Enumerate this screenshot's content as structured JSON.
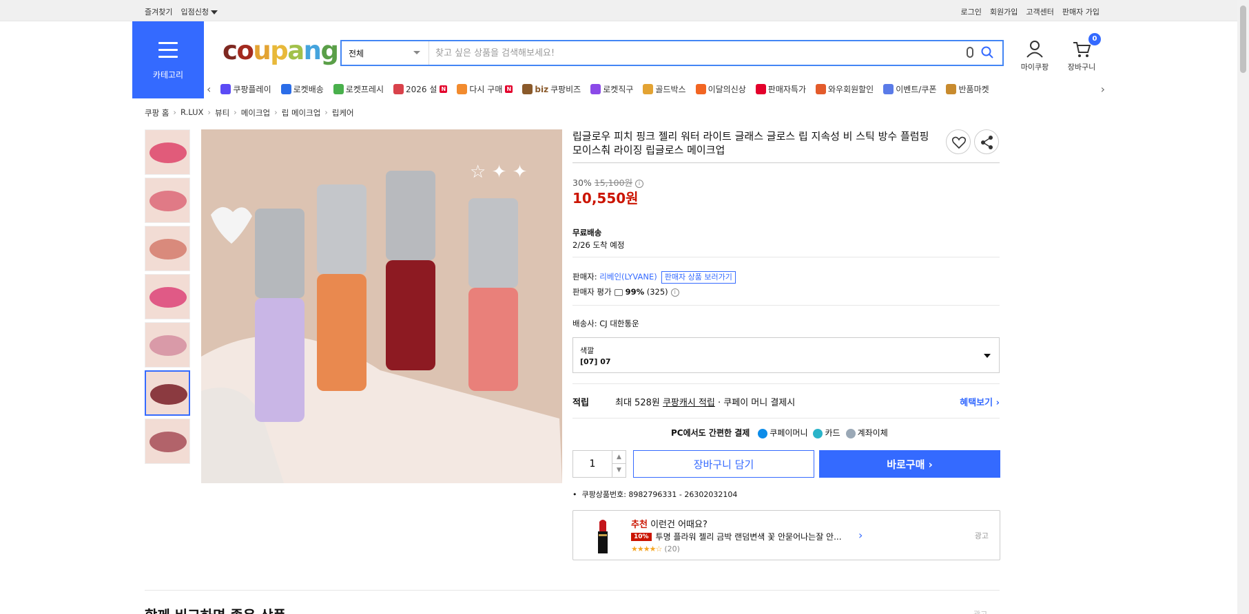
{
  "topbar": {
    "left": [
      "즐겨찾기",
      "입점신청"
    ],
    "right": [
      "로그인",
      "회원가입",
      "고객센터",
      "판매자 가입"
    ]
  },
  "category_button": {
    "label": "카테고리"
  },
  "logo": {
    "letters": [
      "c",
      "o",
      "u",
      "p",
      "a",
      "n",
      "g"
    ],
    "colors": [
      "#7e2821",
      "#a32a1f",
      "#e3a333",
      "#e8b93a",
      "#a2c14b",
      "#45a4dd",
      "#5a9f48"
    ]
  },
  "search": {
    "category": "전체",
    "placeholder": "찾고 싶은 상품을 검색해보세요!"
  },
  "header_icons": {
    "mycoupang": "마이쿠팡",
    "cart": "장바구니",
    "cart_count": "0"
  },
  "nav": [
    {
      "label": "쿠팡플레이",
      "icon": "play-icon",
      "color": "#5b4bf5"
    },
    {
      "label": "로켓배송",
      "icon": "rocket-icon",
      "color": "#2b6de8"
    },
    {
      "label": "로켓프레시",
      "icon": "rocket-fresh-icon",
      "color": "#49b04c"
    },
    {
      "label": "2026 설",
      "icon": "gift-icon",
      "color": "#d9424b",
      "badge": "N"
    },
    {
      "label": "다시 구매",
      "icon": "house-icon",
      "color": "#f28b2e",
      "badge": "N"
    },
    {
      "label": "쿠팡비즈",
      "icon": "biz-icon",
      "color": "#8a5a2b",
      "prefix": "biz"
    },
    {
      "label": "로켓직구",
      "icon": "globe-icon",
      "color": "#8b4ae8"
    },
    {
      "label": "골드박스",
      "icon": "goldbox-icon",
      "color": "#e3a333"
    },
    {
      "label": "이달의신상",
      "icon": "bag-icon",
      "color": "#f26522"
    },
    {
      "label": "판매자특가",
      "icon": "percent-icon",
      "color": "#e3002b"
    },
    {
      "label": "와우회원할인",
      "icon": "wow-icon",
      "color": "#e35b2b"
    },
    {
      "label": "이벤트/쿠폰",
      "icon": "coupon-icon",
      "color": "#5a7be8"
    },
    {
      "label": "반품마켓",
      "icon": "market-icon",
      "color": "#c88b2e"
    }
  ],
  "breadcrumb": [
    "쿠팡 홈",
    "R.LUX",
    "뷰티",
    "메이크업",
    "립 메이크업",
    "립케어"
  ],
  "thumbnails": [
    {
      "color": "#e15b7a"
    },
    {
      "color": "#e07a86"
    },
    {
      "color": "#d98a7c"
    },
    {
      "color": "#e05a86"
    },
    {
      "color": "#d99aa8"
    },
    {
      "color": "#8b3a40"
    },
    {
      "color": "#b2636a"
    }
  ],
  "product": {
    "title": "립글로우 피치 핑크 젤리 워터 라이트 글래스 글로스 립 지속성 비 스틱 방수 플럼핑 모이스춰 라이징 립글로스 메이크업",
    "discount": "30%",
    "original_price": "15,100원",
    "price": "10,550원",
    "shipping_label": "무료배송",
    "arrival": "2/26 도착 예정",
    "seller_label": "판매자:",
    "seller_name": "리베인(LYVANE)",
    "seller_link": "판매자 상품 보러가기",
    "rating_label": "판매자 평가",
    "rating_value": "99%",
    "rating_count": "(325)",
    "courier": "배송사:  CJ 대한통운",
    "option_label": "색깔",
    "option_value": "[07] 07",
    "reward_label": "적립",
    "reward_text_1": "최대 528원",
    "reward_text_link": "쿠팡캐시 적립",
    "reward_text_2": "· 쿠페이 머니 결제시",
    "reward_more": "혜택보기",
    "pay_title": "PC에서도 간편한 결제",
    "pay_methods": [
      {
        "label": "쿠페이머니",
        "color": "#0c8ce9"
      },
      {
        "label": "카드",
        "color": "#2ab4c9"
      },
      {
        "label": "계좌이체",
        "color": "#9aa8b6"
      }
    ],
    "quantity": "1",
    "cart_button": "장바구니 담기",
    "buy_button": "바로구매",
    "product_id": "쿠팡상품번호: 8982796331 - 26302032104"
  },
  "recommend": {
    "prefix": "추천",
    "title": "이런건 어때요?",
    "discount": "10%",
    "name": "투명 플라워 젤리 금박 랜덤변색 꽃 안묻어나는잘 안...",
    "stars": "★★★★☆",
    "count": "(20)",
    "ad": "광고"
  },
  "bottom": {
    "title": "함께 비교하면 좋은 상품",
    "ad": "광고"
  }
}
